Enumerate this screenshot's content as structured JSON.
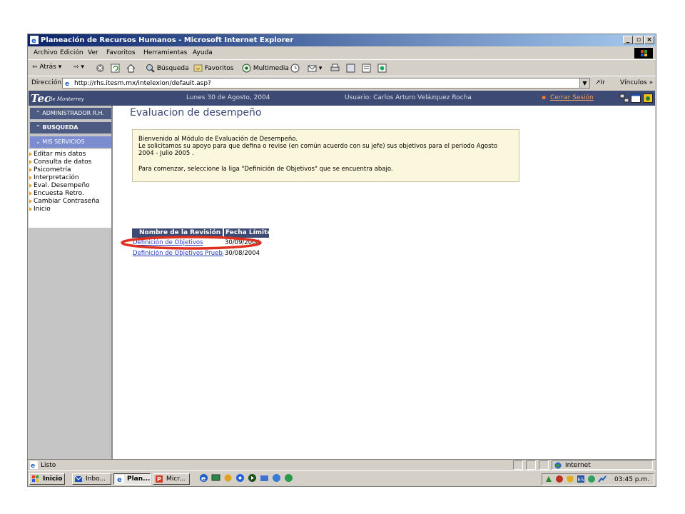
{
  "window": {
    "title": "Planeación de Recursos Humanos - Microsoft Internet Explorer"
  },
  "menu": [
    "Archivo",
    "Edición",
    "Ver",
    "Favoritos",
    "Herramientas",
    "Ayuda"
  ],
  "toolbar": {
    "back": "Atrás",
    "search": "Búsqueda",
    "favorites": "Favoritos",
    "multimedia": "Multimedia"
  },
  "address": {
    "label": "Dirección",
    "url": "http://rhs.itesm.mx/intelexion/default.asp?",
    "go": "Ir",
    "links": "Vínculos"
  },
  "header": {
    "logo_main": "Tec",
    "logo_sub": "de Monterrey",
    "date": "Lunes 30 de Agosto, 2004",
    "user": "Usuario: Carlos Arturo Velázquez Rocha",
    "logout": "Cerrar Sesión"
  },
  "sidebar": {
    "admin": "ADMINISTRADOR R.H.",
    "search": "BUSQUEDA",
    "services": "MIS SERVICIOS",
    "items": [
      "Editar mis datos",
      "Consulta de datos",
      "Psicometría",
      "Interpretación",
      "Eval. Desempeño",
      "Encuesta Retro.",
      "Cambiar Contraseña",
      "Inicio"
    ]
  },
  "main": {
    "title": "Evaluacion de desempeño",
    "info_line1": "Bienvenido al Módulo de Evaluación de Desempeño.",
    "info_line2": "Le solicitamos su apoyo para que defina o revise (en común acuerdo con su jefe) sus objetivos para el periodo Agosto",
    "info_line3": "2004 - Julio 2005 .",
    "info_line4": "Para comenzar, seleccione la liga \"Definición de Objetivos\" que se encuentra abajo.",
    "table": {
      "headers": [
        "Nombre de la Revisión",
        "Fecha Límite"
      ],
      "rows": [
        {
          "name": "Definición de Objetivos",
          "date": "30/09/2004"
        },
        {
          "name": "Definición de Objetivos Prueba",
          "date": "30/08/2004"
        }
      ]
    },
    "highlight_color": "#e03020"
  },
  "status": {
    "text": "Listo",
    "zone": "Internet"
  },
  "taskbar": {
    "start": "Inicio",
    "tasks": [
      "Inbo...",
      "Plan...",
      "Micr..."
    ],
    "clock": "03:45 p.m."
  }
}
